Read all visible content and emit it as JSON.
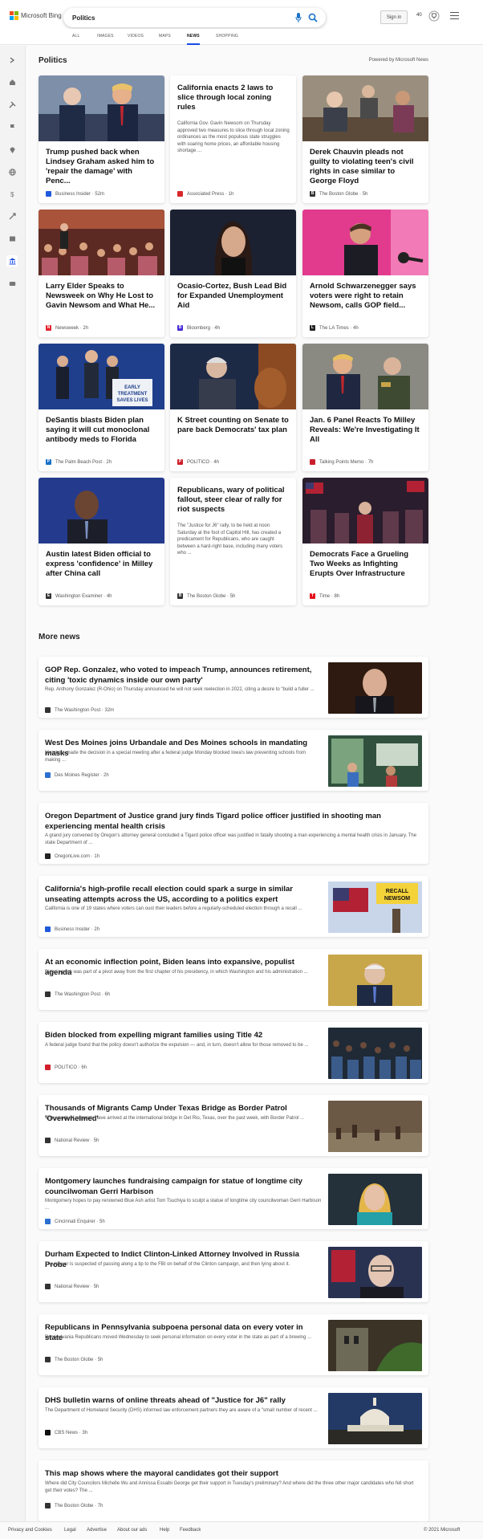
{
  "header": {
    "brand": "Microsoft Bing",
    "search_value": "Politics",
    "sign_in": "Sign in",
    "points": "40"
  },
  "tabs": [
    "ALL",
    "IMAGES",
    "VIDEOS",
    "MAPS",
    "NEWS",
    "SHOPPING"
  ],
  "active_tab": "NEWS",
  "section": {
    "title": "Politics",
    "powered_by": "Powered by Microsoft News"
  },
  "cards": [
    {
      "title": "Trump pushed back when Lindsey Graham asked him to 'repair the damage' with Penc...",
      "source": "Business Insider",
      "age": "52m",
      "favicon": "#1e5adb"
    },
    {
      "title": "California enacts 2 laws to slice through local zoning rules",
      "desc": "California Gov. Gavin Newsom on Thursday approved two measures to slice through local zoning ordinances as the most populous state struggles with soaring home prices, an affordable housing shortage ...",
      "source": "Associated Press",
      "age": "1h",
      "favicon": "#d8272b"
    },
    {
      "title": "Derek Chauvin pleads not guilty to violating teen's civil rights in case similar to George Floyd",
      "source": "The Boston Globe",
      "age": "5h",
      "favicon": "#333333"
    },
    {
      "title": "Larry Elder Speaks to Newsweek on Why He Lost to Gavin Newsom and What He...",
      "source": "Newsweek",
      "age": "2h",
      "favicon": "#e4222b"
    },
    {
      "title": "Ocasio-Cortez, Bush Lead Bid for Expanded Unemployment Aid",
      "source": "Bloomberg",
      "age": "4h",
      "favicon": "#472bd6"
    },
    {
      "title": "Arnold Schwarzenegger says voters were right to retain Newsom, calls GOP field...",
      "source": "The LA Times",
      "age": "4h",
      "favicon": "#222222"
    },
    {
      "title": "DeSantis blasts Biden plan saying it will cut monoclonal antibody meds to Florida",
      "source": "The Palm Beach Post",
      "age": "2h",
      "favicon": "#1670c9"
    },
    {
      "title": "K Street counting on Senate to pare back Democrats' tax plan",
      "source": "POLITICO",
      "age": "4h",
      "favicon": "#d11f2b"
    },
    {
      "title": "Jan. 6 Panel Reacts To Milley Reveals: We're Investigating It All",
      "source": "Talking Points Memo",
      "age": "7h",
      "favicon": "#c91f2c"
    },
    {
      "title": "Austin latest Biden official to express 'confidence' in Milley after China call",
      "source": "Washington Examiner",
      "age": "4h",
      "favicon": "#333333"
    },
    {
      "title": "Republicans, wary of political fallout, steer clear of rally for riot suspects",
      "desc": "The \"Justice for J6\" rally, to be held at noon Saturday at the foot of Capitol Hill, has created a predicament for Republicans, who are caught between a hard-right base, including many voters who ...",
      "source": "The Boston Globe",
      "age": "5h",
      "favicon": "#333333"
    },
    {
      "title": "Democrats Face a Grueling Two Weeks as Infighting Erupts Over Infrastructure",
      "source": "Time",
      "age": "8h",
      "favicon": "#e5101b"
    }
  ],
  "more_news": {
    "title": "More news",
    "items": [
      {
        "title": "GOP Rep. Gonzalez, who voted to impeach Trump, announces retirement, citing 'toxic dynamics inside our own party'",
        "desc": "Rep. Anthony Gonzalez (R-Ohio) on Thursday announced he will not seek reelection in 2022, citing a desire to \"build a fuller ...",
        "source": "The Washington Post",
        "age": "32m",
        "favicon": "#333333",
        "thumb": true
      },
      {
        "title": "West Des Moines joins Urbandale and Des Moines schools in mandating masks",
        "desc": "Members made the decision in a special meeting after a federal judge Monday blocked Iowa's law preventing schools from making ...",
        "source": "Des Moines Register",
        "age": "2h",
        "favicon": "#2c6fd1",
        "thumb": true
      },
      {
        "title": "Oregon Department of Justice grand jury finds Tigard police officer justified in shooting man experiencing mental health crisis",
        "desc": "A grand jury convened by Oregon's attorney general concluded a Tigard police officer was justified in fatally shooting a man experiencing a mental health crisis in January. The state Department of ...",
        "source": "OregonLive.com",
        "age": "1h",
        "favicon": "#222222",
        "thumb": false
      },
      {
        "title": "California's high-profile recall election could spark a surge in similar unseating attempts across the US, according to a politics expert",
        "desc": "California is one of 19 states where voters can oust their leaders before a regularly-scheduled election through a recall ...",
        "source": "Business Insider",
        "age": "2h",
        "favicon": "#1e5adb",
        "thumb": true
      },
      {
        "title": "At an economic inflection point, Biden leans into expansive, populist agenda",
        "desc": "Biden's pitch was part of a pivot away from the first chapter of his presidency, in which Washington and his administration ...",
        "source": "The Washington Post",
        "age": "6h",
        "favicon": "#333333",
        "thumb": true
      },
      {
        "title": "Biden blocked from expelling migrant families using Title 42",
        "desc": "A federal judge found that the policy doesn't authorize the expulsion — and, in turn, doesn't allow for those removed to be ...",
        "source": "POLITICO",
        "age": "6h",
        "favicon": "#d11f2b",
        "thumb": true
      },
      {
        "title": "Thousands of Migrants Camp Under Texas Bridge as Border Patrol 'Overwhelmed'",
        "desc": "Thousands of migrants have arrived at the international bridge in Del Rio, Texas, over the past week, with Border Patrol ...",
        "source": "National Review",
        "age": "5h",
        "favicon": "#333333",
        "thumb": true
      },
      {
        "title": "Montgomery launches fundraising campaign for statue of longtime city councilwoman Gerri Harbison",
        "desc": "Montgomery hopes to pay renowned Blue Ash artist Tom Tsuchiya to sculpt a statue of longtime city councilwoman Gerri Harbison ...",
        "source": "Cincinnati Enquirer",
        "age": "5h",
        "favicon": "#2c6fd1",
        "thumb": true
      },
      {
        "title": "Durham Expected to Indict Clinton-Linked Attorney Involved in Russia Probe",
        "desc": "The lawyer is suspected of passing along a tip to the FBI on behalf of the Clinton campaign, and then lying about it.",
        "source": "National Review",
        "age": "5h",
        "favicon": "#333333",
        "thumb": true
      },
      {
        "title": "Republicans in Pennsylvania subpoena personal data on every voter in state",
        "desc": "Pennsylvania Republicans moved Wednesday to seek personal information on every voter in the state as part of a brewing ...",
        "source": "The Boston Globe",
        "age": "5h",
        "favicon": "#333333",
        "thumb": true
      },
      {
        "title": "DHS bulletin warns of online threats ahead of \"Justice for J6\" rally",
        "desc": "The Department of Homeland Security (DHS) informed law enforcement partners they are aware of a \"small number of recent ...",
        "source": "CBS News",
        "age": "3h",
        "favicon": "#111111",
        "thumb": true
      },
      {
        "title": "This map shows where the mayoral candidates got their support",
        "desc": "Where did City Councilors Michelle Wu and Annissa Essaibi George get their support in Tuesday's preliminary? And where did the three other major candidates who fell short get their votes? The ...",
        "source": "The Boston Globe",
        "age": "7h",
        "favicon": "#333333",
        "thumb": false
      }
    ]
  },
  "footer": {
    "links": [
      "Privacy and Cookies",
      "Legal",
      "Advertise",
      "About our ads",
      "Help",
      "Feedback"
    ],
    "copyright": "© 2021 Microsoft"
  }
}
